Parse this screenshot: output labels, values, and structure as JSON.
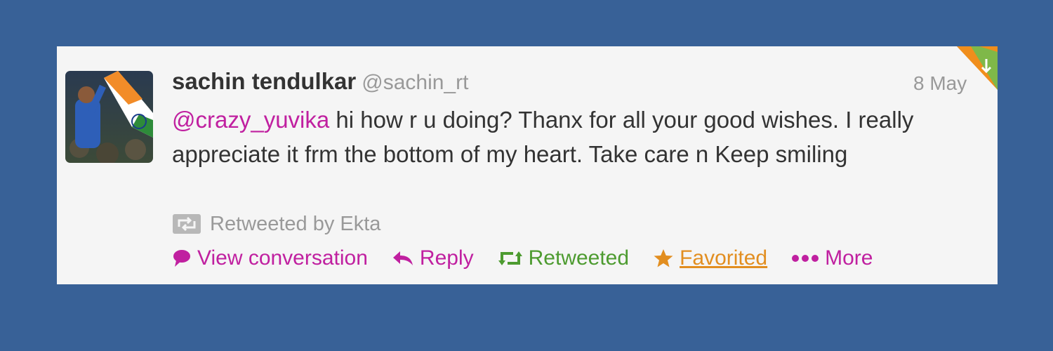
{
  "tweet": {
    "author_name": "sachin tendulkar",
    "author_handle": "@sachin_rt",
    "timestamp": "8 May",
    "mention": "@crazy_yuvika",
    "body": " hi how r u doing? Thanx for all your good wishes. I really appreciate it frm the bottom of my heart. Take care n Keep smiling",
    "retweeted_by": "Retweeted by Ekta"
  },
  "actions": {
    "view_conversation": "View conversation",
    "reply": "Reply",
    "retweeted": "Retweeted",
    "favorited": "Favorited",
    "more": "More"
  },
  "icons": {
    "view_conversation": "speech-bubble-icon",
    "reply": "reply-arrow-icon",
    "retweeted": "retweet-icon",
    "favorited": "star-icon",
    "more": "ellipsis-icon",
    "retweeted_by": "retweet-box-icon",
    "corner": "favorited-retweeted-corner-badge"
  },
  "colors": {
    "page_background": "#386197",
    "card_background": "#f5f5f5",
    "text": "#333333",
    "muted": "#999999",
    "link_purple": "#c020a0",
    "retweet_green": "#4d9b30",
    "favorite_orange": "#e28e20"
  }
}
